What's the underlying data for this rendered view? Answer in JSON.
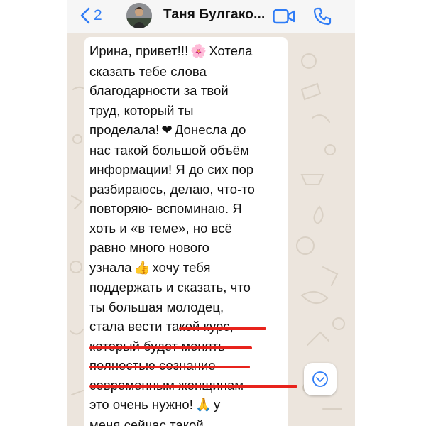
{
  "header": {
    "back_count": "2",
    "contact_name": "Таня Булгако..."
  },
  "colors": {
    "accent": "#2f7cf6",
    "chat_background": "#ece5dd",
    "underline": "#e8231c"
  },
  "message": {
    "lines": [
      {
        "parts": [
          "Ирина, привет!!!",
          "🌸",
          "Хотела"
        ]
      },
      {
        "parts": [
          "сказать тебе слова"
        ]
      },
      {
        "parts": [
          "благодарности за твой"
        ]
      },
      {
        "parts": [
          "труд, который ты"
        ]
      },
      {
        "parts": [
          "проделала!",
          "❤",
          "Донесла до"
        ]
      },
      {
        "parts": [
          "нас такой большой объём"
        ]
      },
      {
        "parts": [
          "информации! Я до сих пор"
        ]
      },
      {
        "parts": [
          "разбираюсь, делаю, что-то"
        ]
      },
      {
        "parts": [
          "повторяю- вспоминаю. Я"
        ]
      },
      {
        "parts": [
          "хоть и «в теме», но всё"
        ]
      },
      {
        "parts": [
          "равно много нового"
        ]
      },
      {
        "parts": [
          "узнала",
          "👍",
          "хочу тебя"
        ]
      },
      {
        "parts": [
          "поддержать и сказать, что"
        ]
      },
      {
        "parts": [
          "ты большая молодец,"
        ]
      },
      {
        "parts": [
          "стала вести такой курс,"
        ]
      },
      {
        "parts": [
          "который будет менять"
        ]
      },
      {
        "parts": [
          "полностью сознание-"
        ]
      },
      {
        "parts": [
          "современным женщинам"
        ]
      },
      {
        "parts": [
          "это очень нужно!",
          "🙏",
          "у"
        ]
      },
      {
        "parts": [
          "меня сейчас такой"
        ]
      }
    ]
  },
  "icons": {
    "back": "chevron-left-icon",
    "video": "video-camera-icon",
    "call": "phone-icon",
    "scroll": "chevron-down-icon"
  }
}
